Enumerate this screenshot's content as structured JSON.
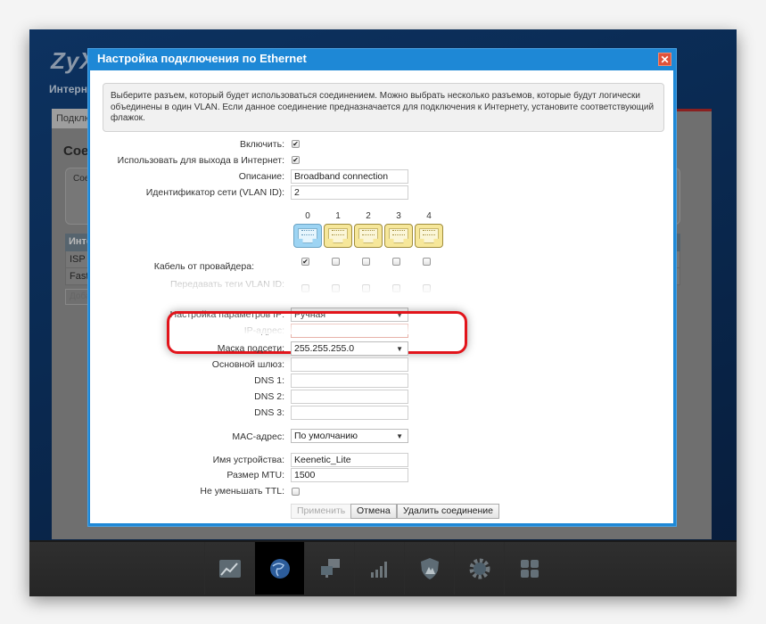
{
  "background": {
    "logo": "ZyXEL",
    "page_heading": "Интернет",
    "tab": "Подключения",
    "title": "Соединения",
    "note": "Соединения, необходимые для настройки, указаны...",
    "table_header": "Интерфейс",
    "table_rows": [
      "ISP",
      "FastEthernet"
    ],
    "add_button": "Добавить"
  },
  "dialog": {
    "title": "Настройка подключения по Ethernet",
    "close_icon": "close-icon",
    "info_text": "Выберите разъем, который будет использоваться соединением. Можно выбрать несколько разъемов, которые будут логически объединены в один VLAN. Если данное соединение предназначается для подключения к Интернету, установите соответствующий флажок.",
    "fields": {
      "enable": {
        "label": "Включить:",
        "checked": true
      },
      "use_for_internet": {
        "label": "Использовать для выхода в Интернет:",
        "checked": true
      },
      "description": {
        "label": "Описание:",
        "value": "Broadband connection"
      },
      "vlan_id": {
        "label": "Идентификатор сети (VLAN ID):",
        "value": "2"
      },
      "ports": [
        {
          "number": "0",
          "active": true,
          "cable": true
        },
        {
          "number": "1",
          "active": false,
          "cable": false
        },
        {
          "number": "2",
          "active": false,
          "cable": false
        },
        {
          "number": "3",
          "active": false,
          "cable": false
        },
        {
          "number": "4",
          "active": false,
          "cable": false
        }
      ],
      "cable_label": "Кабель от провайдера:",
      "vlan_tags_label": "Передавать теги VLAN ID:",
      "ip_settings": {
        "label": "Настройка параметров IP:",
        "value": "Ручная"
      },
      "ip_address": {
        "label": "IP-адрес:",
        "value": ""
      },
      "subnet_mask": {
        "label": "Маска подсети:",
        "value": "255.255.255.0"
      },
      "gateway": {
        "label": "Основной шлюз:",
        "value": ""
      },
      "dns1": {
        "label": "DNS 1:",
        "value": ""
      },
      "dns2": {
        "label": "DNS 2:",
        "value": ""
      },
      "dns3": {
        "label": "DNS 3:",
        "value": ""
      },
      "mac": {
        "label": "MAC-адрес:",
        "value": "По умолчанию"
      },
      "device_name": {
        "label": "Имя устройства:",
        "value": "Keenetic_Lite"
      },
      "mtu": {
        "label": "Размер MTU:",
        "value": "1500"
      },
      "no_ttl_decrement": {
        "label": "Не уменьшать TTL:",
        "checked": false
      }
    },
    "buttons": {
      "apply": "Применить",
      "cancel": "Отмена",
      "delete": "Удалить соединение"
    }
  },
  "taskbar": {
    "items": [
      {
        "name": "monitor",
        "icon": "chart-icon",
        "active": false
      },
      {
        "name": "internet",
        "icon": "globe-icon",
        "active": true
      },
      {
        "name": "home-network",
        "icon": "computers-icon",
        "active": false
      },
      {
        "name": "wifi",
        "icon": "signal-bars-icon",
        "active": false
      },
      {
        "name": "security",
        "icon": "shield-icon",
        "active": false
      },
      {
        "name": "system",
        "icon": "gear-icon",
        "active": false
      },
      {
        "name": "apps",
        "icon": "grid-icon",
        "active": false
      }
    ]
  },
  "colors": {
    "dialog_header": "#1e88d6",
    "highlight": "#e2141b",
    "port_active": "#9dd4f3",
    "port_inactive": "#f6e79a"
  }
}
